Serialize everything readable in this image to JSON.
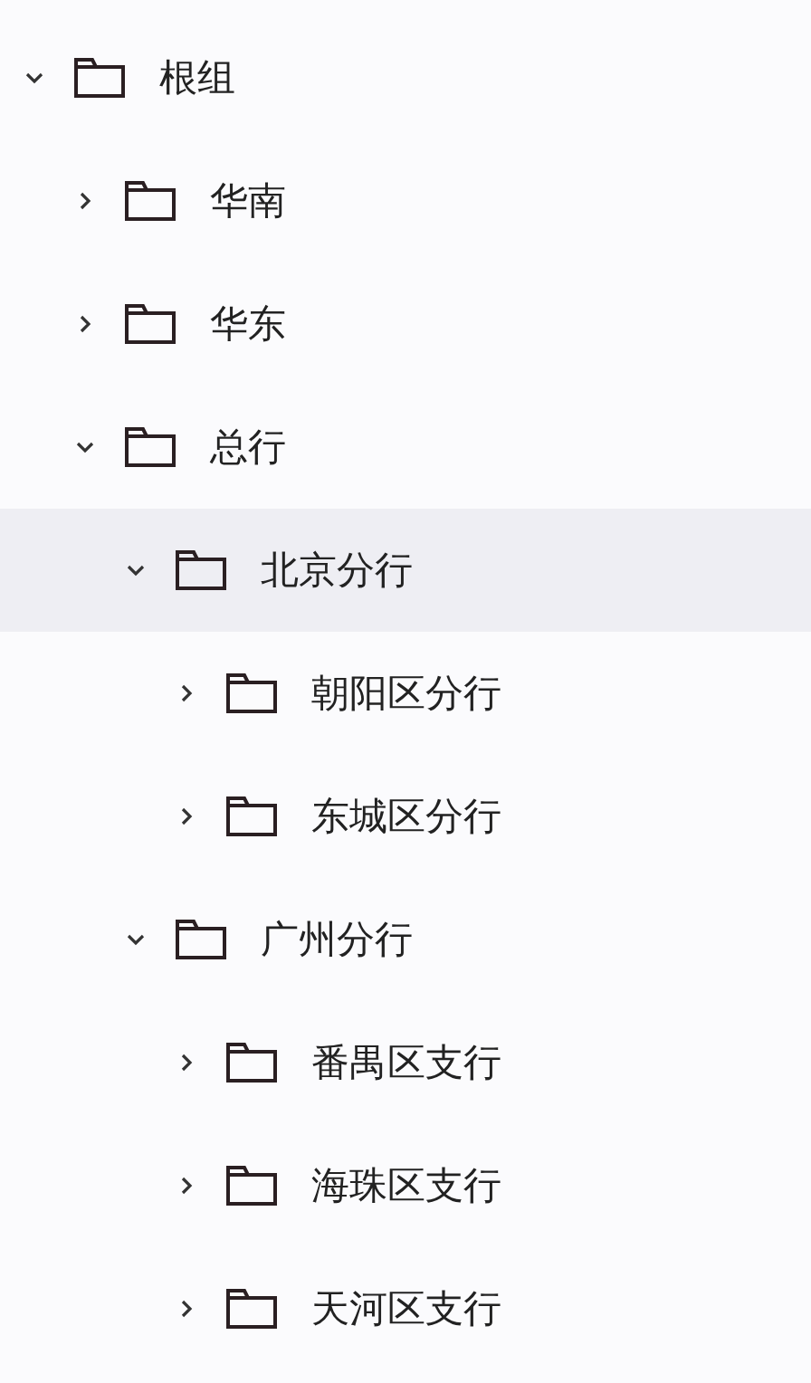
{
  "tree": [
    {
      "label": "根组",
      "expanded": true,
      "selected": false,
      "children": [
        {
          "label": "华南",
          "expanded": false,
          "selected": false
        },
        {
          "label": "华东",
          "expanded": false,
          "selected": false
        },
        {
          "label": "总行",
          "expanded": true,
          "selected": false,
          "children": [
            {
              "label": "北京分行",
              "expanded": true,
              "selected": true,
              "children": [
                {
                  "label": "朝阳区分行",
                  "expanded": false,
                  "selected": false
                },
                {
                  "label": "东城区分行",
                  "expanded": false,
                  "selected": false
                }
              ]
            },
            {
              "label": "广州分行",
              "expanded": true,
              "selected": false,
              "children": [
                {
                  "label": "番禺区支行",
                  "expanded": false,
                  "selected": false
                },
                {
                  "label": "海珠区支行",
                  "expanded": false,
                  "selected": false
                },
                {
                  "label": "天河区支行",
                  "expanded": false,
                  "selected": false
                }
              ]
            }
          ]
        }
      ]
    }
  ]
}
